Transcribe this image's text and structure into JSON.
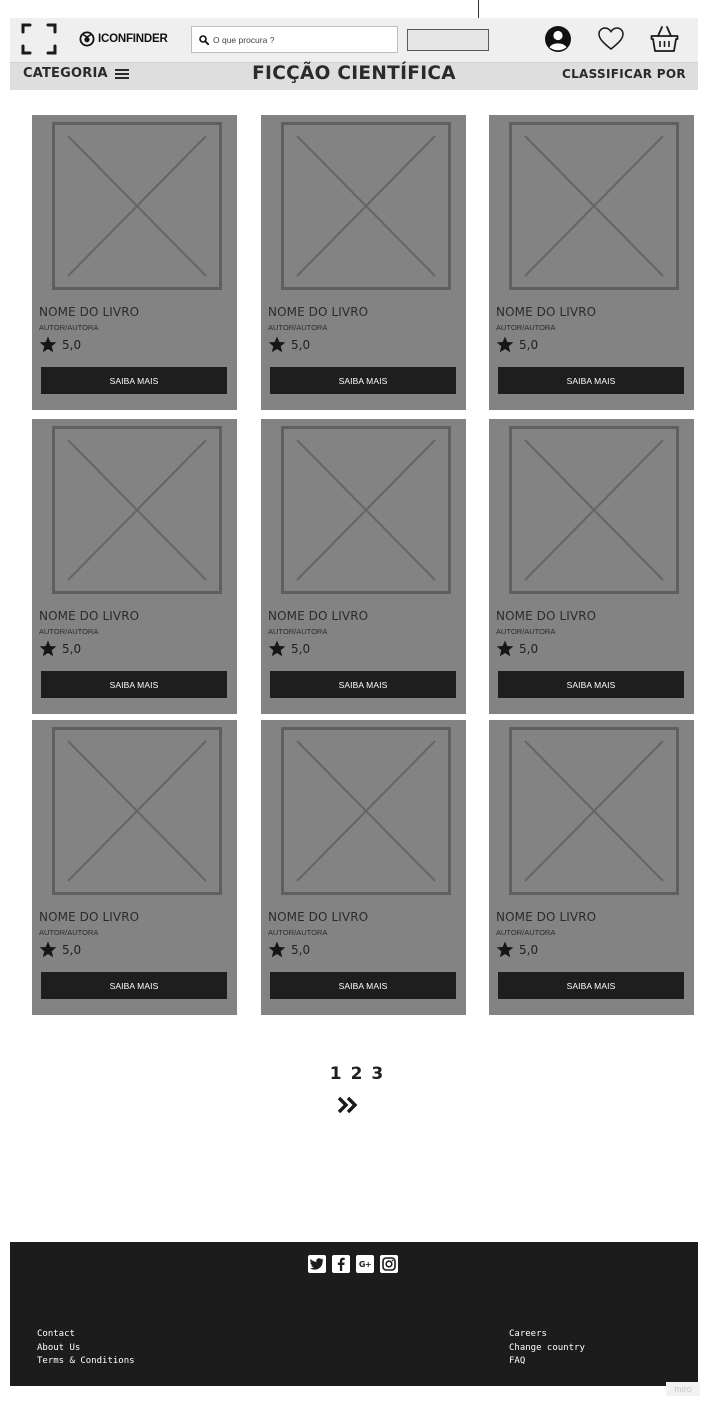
{
  "header": {
    "logo_text": "ICONFINDER",
    "search_placeholder": "O que procura ?",
    "category_label": "CATEGORIA",
    "page_title": "FICÇÃO CIENTÍFICA",
    "sort_label": "CLASSIFICAR POR",
    "icons": [
      "scan-icon",
      "search-icon",
      "user-icon",
      "heart-icon",
      "basket-icon",
      "menu-icon"
    ]
  },
  "products": [
    {
      "name": "NOME DO LIVRO",
      "author": "AUTOR/AUTORA",
      "rating": "5,0",
      "button": "SAIBA MAIS"
    },
    {
      "name": "NOME DO LIVRO",
      "author": "AUTOR/AUTORA",
      "rating": "5,0",
      "button": "SAIBA MAIS"
    },
    {
      "name": "NOME DO LIVRO",
      "author": "AUTOR/AUTORA",
      "rating": "5,0",
      "button": "SAIBA MAIS"
    },
    {
      "name": "NOME DO LIVRO",
      "author": "AUTOR/AUTORA",
      "rating": "5,0",
      "button": "SAIBA MAIS"
    },
    {
      "name": "NOME DO LIVRO",
      "author": "AUTOR/AUTORA",
      "rating": "5,0",
      "button": "SAIBA MAIS"
    },
    {
      "name": "NOME DO LIVRO",
      "author": "AUTOR/AUTORA",
      "rating": "5,0",
      "button": "SAIBA MAIS"
    },
    {
      "name": "NOME DO LIVRO",
      "author": "AUTOR/AUTORA",
      "rating": "5,0",
      "button": "SAIBA MAIS"
    },
    {
      "name": "NOME DO LIVRO",
      "author": "AUTOR/AUTORA",
      "rating": "5,0",
      "button": "SAIBA MAIS"
    },
    {
      "name": "NOME DO LIVRO",
      "author": "AUTOR/AUTORA",
      "rating": "5,0",
      "button": "SAIBA MAIS"
    }
  ],
  "pagination": {
    "pages": [
      "1",
      "2",
      "3"
    ],
    "next_icon": "double-chevron-right-icon"
  },
  "footer": {
    "social": [
      "twitter-icon",
      "facebook-icon",
      "google-plus-icon",
      "instagram-icon"
    ],
    "left_links": [
      "Contact",
      "About Us",
      "Terms & Conditions"
    ],
    "right_links": [
      "Careers",
      "Change country",
      "FAQ"
    ]
  },
  "watermark": "miro",
  "colors": {
    "header_bg": "#efefef",
    "nav_bg": "#dedede",
    "card_bg": "#838383",
    "button_bg": "#1e1e1e",
    "footer_bg": "#1c1c1c"
  }
}
